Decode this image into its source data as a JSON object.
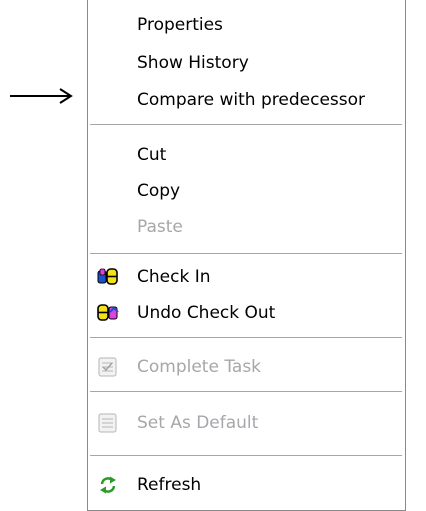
{
  "menu": {
    "items": [
      {
        "label": "Properties",
        "enabled": true,
        "icon": null
      },
      {
        "label": "Show History",
        "enabled": true,
        "icon": null
      },
      {
        "label": "Compare with predecessor",
        "enabled": true,
        "icon": null
      },
      {
        "label": "Cut",
        "enabled": true,
        "icon": null
      },
      {
        "label": "Copy",
        "enabled": true,
        "icon": null
      },
      {
        "label": "Paste",
        "enabled": false,
        "icon": null
      },
      {
        "label": "Check In",
        "enabled": true,
        "icon": "check-in-icon"
      },
      {
        "label": "Undo Check Out",
        "enabled": true,
        "icon": "undo-check-out-icon"
      },
      {
        "label": "Complete Task",
        "enabled": false,
        "icon": "complete-task-icon"
      },
      {
        "label": "Set As Default",
        "enabled": false,
        "icon": "set-as-default-icon"
      },
      {
        "label": "Refresh",
        "enabled": true,
        "icon": "refresh-icon"
      }
    ]
  },
  "colors": {
    "disabled_text": "#a7a6aa",
    "separator": "#a7a6aa",
    "menu_border": "#8a8a8a"
  }
}
